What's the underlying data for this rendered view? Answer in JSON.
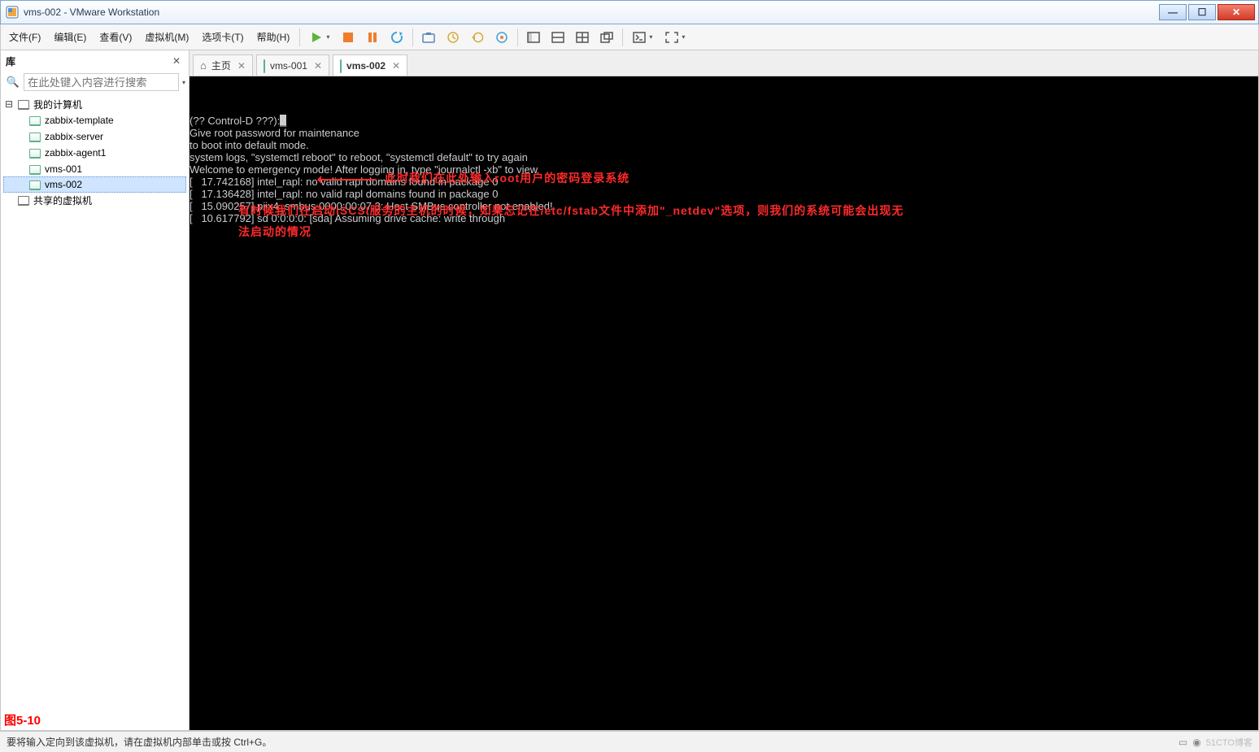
{
  "window": {
    "title": "vms-002 - VMware Workstation"
  },
  "menu": {
    "file": "文件(F)",
    "edit": "编辑(E)",
    "view": "查看(V)",
    "vm": "虚拟机(M)",
    "tabs": "选项卡(T)",
    "help": "帮助(H)"
  },
  "sidebar": {
    "header": "库",
    "close": "✕",
    "search_placeholder": "在此处键入内容进行搜索",
    "root": "我的计算机",
    "items": [
      {
        "label": "zabbix-template"
      },
      {
        "label": "zabbix-server"
      },
      {
        "label": "zabbix-agent1"
      },
      {
        "label": "vms-001"
      },
      {
        "label": "vms-002"
      }
    ],
    "shared": "共享的虚拟机",
    "figure_label": "图5-10"
  },
  "tabs": {
    "home": "主页",
    "items": [
      {
        "label": "vms-001",
        "active": false
      },
      {
        "label": "vms-002",
        "active": true
      }
    ]
  },
  "console": {
    "lines": [
      "[   10.617792] sd 0:0:0:0: [sda] Assuming drive cache: write through",
      "[   15.090257] piix4_smbus 0000:00:07.3: Host SMBus controller not enabled!",
      "[   17.136428] intel_rapl: no valid rapl domains found in package 0",
      "[   17.742168] intel_rapl: no valid rapl domains found in package 0",
      "Welcome to emergency mode! After logging in, type \"journalctl -xb\" to view",
      "system logs, \"systemctl reboot\" to reboot, \"systemctl default\" to try again",
      "to boot into default mode.",
      "Give root password for maintenance",
      "(?? Control-D ???):"
    ],
    "annotation1": "此时我们在此处输入root用户的密码登录系统",
    "annotation2": "有时候我们在启动iSCSI服务的主机的时候，如果忘记在/etc/fstab文件中添加\"_netdev\"选项，则我们的系统可能会出现无法启动的情况"
  },
  "status": {
    "text": "要将输入定向到该虚拟机，请在虚拟机内部单击或按 Ctrl+G。",
    "watermark": "51CTO博客"
  },
  "icons": {
    "play": "play-icon",
    "stop": "stop-icon",
    "pause": "pause-icon",
    "refresh": "refresh-icon",
    "snapshot": "snapshot-icon",
    "clock": "clock-icon",
    "clock_back": "clock-back-icon",
    "manage": "snapshot-manage-icon",
    "single": "view-single-icon",
    "split_h": "view-split-h-icon",
    "split_q": "view-quad-icon",
    "detach": "view-detach-icon",
    "unity": "unity-icon",
    "fullscreen": "fullscreen-icon"
  }
}
